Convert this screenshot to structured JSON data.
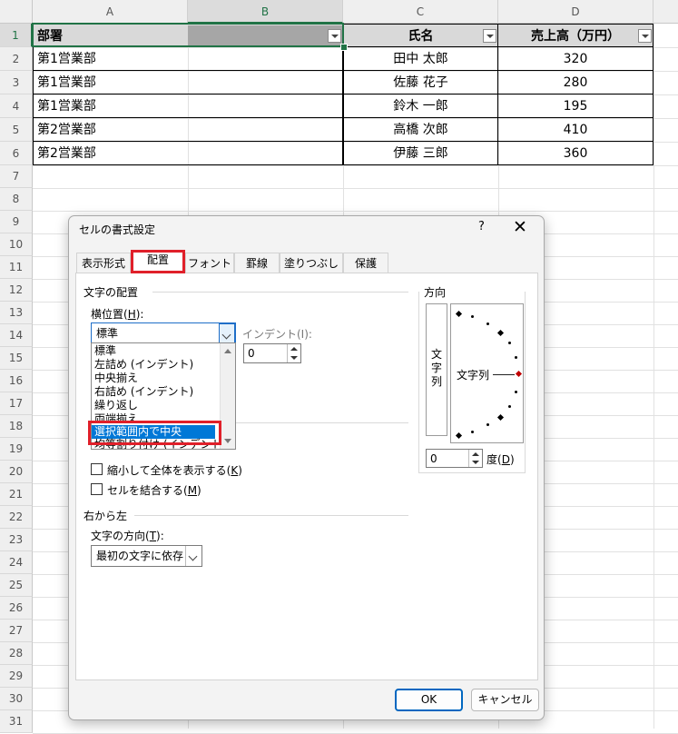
{
  "sheet": {
    "columns": [
      "A",
      "B",
      "C",
      "D"
    ],
    "row_numbers": [
      "1",
      "2",
      "3",
      "4",
      "5",
      "6",
      "7",
      "8",
      "9",
      "10",
      "11",
      "12",
      "13",
      "14",
      "15",
      "16",
      "17",
      "18",
      "19",
      "20",
      "21",
      "22",
      "23",
      "24",
      "25",
      "26",
      "27",
      "28",
      "29",
      "30",
      "31"
    ],
    "headers": {
      "dept": "部署",
      "name": "氏名",
      "sales": "売上高（万円）"
    },
    "rows": [
      {
        "dept": "第1営業部",
        "name": "田中 太郎",
        "sales": "320"
      },
      {
        "dept": "第1営業部",
        "name": "佐藤 花子",
        "sales": "280"
      },
      {
        "dept": "第1営業部",
        "name": "鈴木 一郎",
        "sales": "195"
      },
      {
        "dept": "第2営業部",
        "name": "高橋 次郎",
        "sales": "410"
      },
      {
        "dept": "第2営業部",
        "name": "伊藤 三郎",
        "sales": "360"
      }
    ],
    "colors": {
      "header_fill": "#d9d9d9",
      "selection": "#217346"
    }
  },
  "dialog": {
    "title": "セルの書式設定",
    "help": "?",
    "close": "✕",
    "tabs": [
      {
        "label": "表示形式"
      },
      {
        "label": "配置"
      },
      {
        "label": "フォント"
      },
      {
        "label": "罫線"
      },
      {
        "label": "塗りつぶし"
      },
      {
        "label": "保護"
      }
    ],
    "active_tab": "配置",
    "alignment_group": "文字の配置",
    "horizontal_label": "横位置(",
    "horizontal_key": "H",
    "horizontal_label_end": "):",
    "horizontal_value": "標準",
    "indent_label": "インデント(I):",
    "indent_value": "0",
    "horizontal_options": [
      "標準",
      "左詰め (インデント)",
      "中央揃え",
      "右詰め (インデント)",
      "繰り返し",
      "両端揃え",
      "選択範囲内で中央",
      "均等割り付け (インデント)"
    ],
    "selected_option": "選択範囲内で中央",
    "shrink_to_fit": "縮小して全体を表示する(",
    "shrink_key": "K",
    "merge_cells": "セルを結合する(",
    "merge_key": "M",
    "rtl_group": "右から左",
    "text_direction_label": "文字の方向(",
    "text_direction_key": "T",
    "text_direction_value": "最初の文字に依存",
    "orientation_group": "方向",
    "vertical_text": [
      "文",
      "字",
      "列"
    ],
    "angled_text": "文字列",
    "degrees_value": "0",
    "degrees_label": "度(",
    "degrees_key": "D",
    "close_paren": ")",
    "ok": "OK",
    "cancel": "キャンセル",
    "colors": {
      "highlight": "#e0202a",
      "list_selected": "#0078d7",
      "ok_border": "#0067c0"
    }
  }
}
